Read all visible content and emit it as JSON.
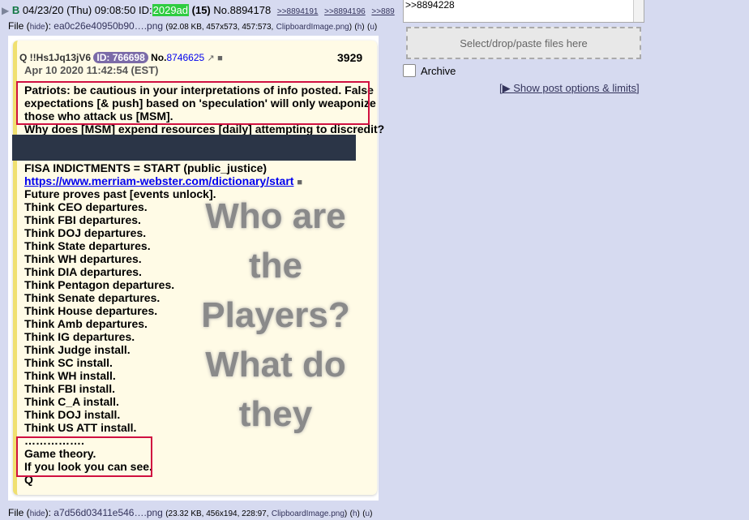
{
  "post": {
    "arrow": "▶",
    "name": "B",
    "datetime": "04/23/20 (Thu) 09:08:50",
    "id_label": "ID:",
    "id_value": "2029ad",
    "count": "(15)",
    "no_label": "No.8894178",
    "backlinks": [
      ">>8894191",
      ">>8894196",
      ">>889"
    ]
  },
  "file1": {
    "label": "File",
    "hide": "hide",
    "name": "ea0c26e40950b90….png",
    "meta_pre": "(92.08 KB, 457x573, 457:573,",
    "orig": "ClipboardImage.png",
    "meta_post": ")",
    "h": "h",
    "u": "u"
  },
  "file2": {
    "label": "File",
    "hide": "hide",
    "name": "a7d56d03411e546….png",
    "meta_pre": "(23.32 KB, 456x194, 228:97,",
    "orig": "ClipboardImage.png",
    "meta_post": ")",
    "h": "h",
    "u": "u"
  },
  "q_post": {
    "trip": "Q !!Hs1Jq13jV6",
    "id_badge": "ID: 766698",
    "no_prefix": "No.",
    "no_link": "8746625",
    "number": "3929",
    "date": "Apr 10 2020 11:42:54 (EST)",
    "lines": [
      "Patriots: be cautious in your interpretations of info posted. False",
      "expectations [& push] based on 'speculation' will only weaponize",
      "those who attack us [MSM].",
      "Why does [MSM] expend resources [daily] attempting to discredit?",
      "",
      "",
      "FISA INDICTMENTS = START (public_justice)",
      "https://www.merriam-webster.com/dictionary/start",
      "Future proves past [events unlock].",
      "Think CEO departures.",
      "Think FBI departures.",
      "Think DOJ departures.",
      "Think State departures.",
      "Think WH departures.",
      "Think DIA departures.",
      "Think Pentagon departures.",
      "Think Senate departures.",
      "Think House departures.",
      "Think Amb departures.",
      "Think IG departures.",
      "Think Judge install.",
      "Think SC install.",
      "Think WH install.",
      "Think FBI install.",
      "Think C_A install.",
      "Think DOJ install.",
      "Think US ATT install.",
      "…………….",
      "Game theory.",
      "If you look you can see.",
      "Q"
    ],
    "overlay_lines": [
      "Who are",
      "the",
      "Players?",
      "What do",
      "they"
    ]
  },
  "reply_form": {
    "textarea_value": ">>8894228",
    "drop_label": "Select/drop/paste files here",
    "archive_label": "Archive",
    "show_options": "[▶ Show post options & limits]"
  }
}
